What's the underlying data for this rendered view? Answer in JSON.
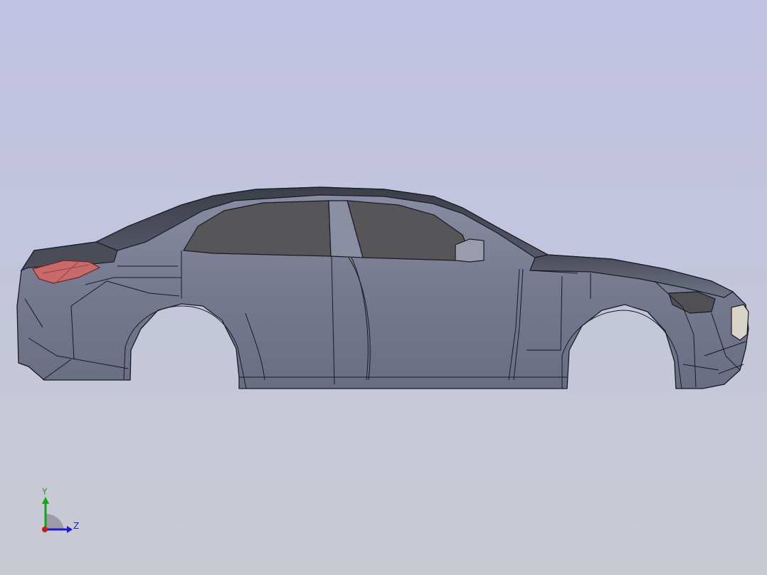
{
  "viewport": {
    "background_top": "#c2c2e2",
    "background_bottom": "#c8cad2"
  },
  "model": {
    "body_color": "#7a7e92",
    "edge_color": "#1a1a22",
    "glass_color": "#555558",
    "taillight_color": "#c86a6a",
    "headlight_color": "#d8d4c8"
  },
  "triad": {
    "y_label": "Y",
    "z_label": "Z",
    "y_color": "#16a316",
    "z_color": "#1c1cc8",
    "x_color": "#c81c1c"
  }
}
